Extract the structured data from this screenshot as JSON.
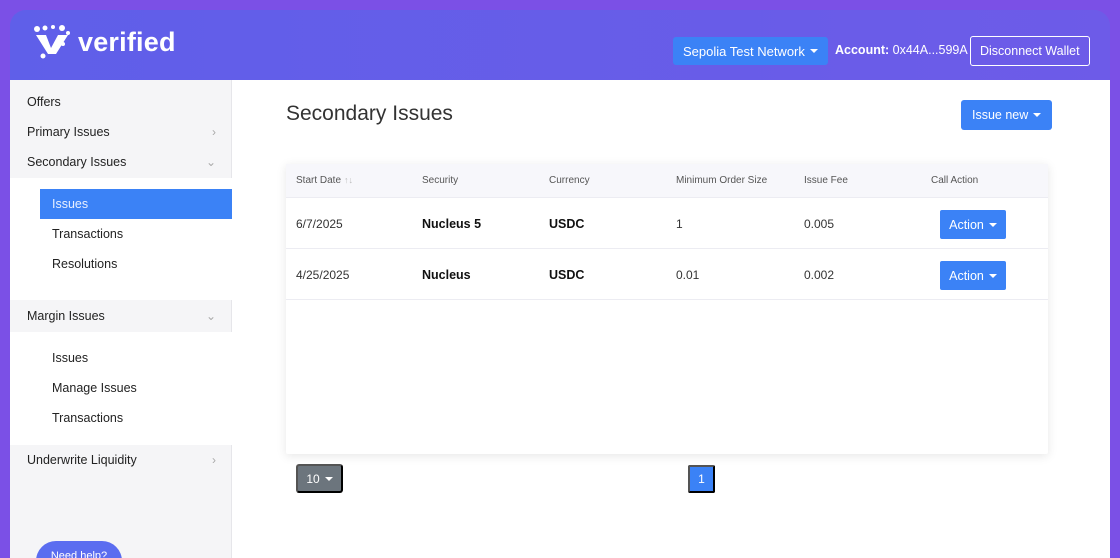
{
  "brand": {
    "name": "verified"
  },
  "header": {
    "network_label": "Sepolia Test Network",
    "account_label": "Account:",
    "account_value": "0x44A...599A",
    "disconnect_label": "Disconnect Wallet"
  },
  "sidebar": {
    "items": [
      {
        "label": "Offers"
      },
      {
        "label": "Primary Issues",
        "chevron": "›"
      },
      {
        "label": "Secondary Issues",
        "chevron": "⌄"
      },
      {
        "label": "Margin Issues",
        "chevron": "⌄"
      },
      {
        "label": "Underwrite Liquidity",
        "chevron": "›"
      }
    ],
    "secondary_sub": [
      {
        "label": "Issues",
        "active": true
      },
      {
        "label": "Transactions"
      },
      {
        "label": "Resolutions"
      }
    ],
    "margin_sub": [
      {
        "label": "Issues"
      },
      {
        "label": "Manage Issues"
      },
      {
        "label": "Transactions"
      }
    ],
    "help_label": "Need help?"
  },
  "main": {
    "title": "Secondary Issues",
    "issue_new_label": "Issue new",
    "table": {
      "headers": [
        "Start Date",
        "Security",
        "Currency",
        "Minimum Order Size",
        "Issue Fee",
        "Call Action"
      ],
      "sort_indicator": "↑↓",
      "rows": [
        {
          "start_date": "6/7/2025",
          "security": "Nucleus 5",
          "currency": "USDC",
          "min_order": "1",
          "issue_fee": "0.005",
          "action": "Action"
        },
        {
          "start_date": "4/25/2025",
          "security": "Nucleus",
          "currency": "USDC",
          "min_order": "0.01",
          "issue_fee": "0.002",
          "action": "Action"
        }
      ]
    },
    "page_size": "10",
    "current_page": "1"
  },
  "colors": {
    "primary": "#3b82f6",
    "header_bg": "#6a5ee8",
    "secondary_btn": "#6c757d"
  }
}
